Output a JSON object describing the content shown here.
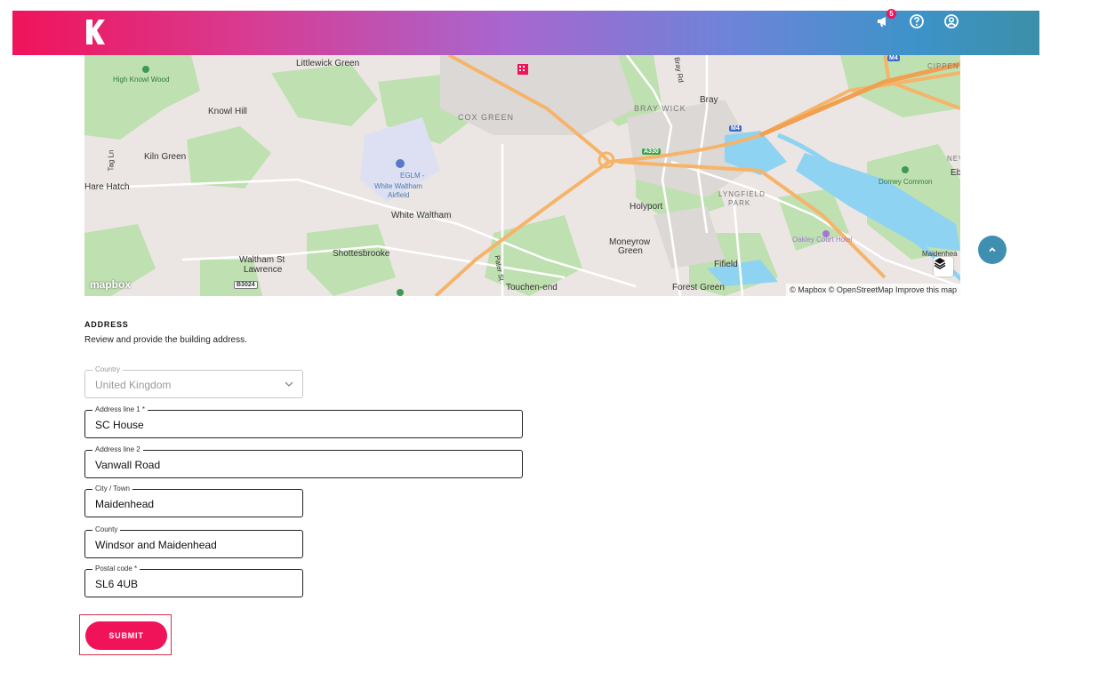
{
  "header": {
    "notifications_count": "5",
    "icons": [
      "megaphone-icon",
      "help-icon",
      "account-icon"
    ],
    "gradient": [
      "#f0135a",
      "#a866cf",
      "#3c8fa8"
    ]
  },
  "map": {
    "labels": {
      "littlewick_green": "Littlewick Green",
      "high_knowl_wood": "High Knowl Wood",
      "knowl_hill": "Knowl Hill",
      "kiln_green": "Kiln Green",
      "hare_hatch": "Hare Hatch",
      "tag_ln": "Tag Ln",
      "eglm": "EGLM -",
      "white_waltham_airfield": "White Waltham",
      "airfield": "Airfield",
      "white_waltham": "White Waltham",
      "waltham_st": "Waltham St",
      "lawrence": "Lawrence",
      "shottesbrooke": "Shottesbrooke",
      "cox_green": "COX GREEN",
      "bray_wick": "BRAY WICK",
      "bray": "Bray",
      "bray_rd": "Bray Rd",
      "holyport": "Holyport",
      "lyngfield": "LYNGFIELD",
      "park": "PARK",
      "moneyrow": "Moneyrow",
      "green": "Green",
      "fifield": "Fifield",
      "pater_st": "Pater St",
      "touchen_end": "Touchen-end",
      "forest_green": "Forest Green",
      "oakley_court": "Oakley Court Hotel",
      "dorney_common": "Dorney Common",
      "cippen": "CIPPEN",
      "maidenhead_edge": "Maidenhea",
      "new": "NEV",
      "eb": "Eb"
    },
    "road_badges": {
      "a330": "A330",
      "m4_top": "M4",
      "m4_mid": "M4",
      "b3024": "B3024"
    },
    "mapbox_logo": "mapbox",
    "attribution": "© Mapbox © OpenStreetMap Improve this map"
  },
  "address": {
    "title": "ADDRESS",
    "description": "Review and provide the building address.",
    "country": {
      "label": "Country",
      "value": "United Kingdom"
    },
    "line1": {
      "label": "Address line 1 *",
      "value": "SC House"
    },
    "line2": {
      "label": "Address line 2",
      "value": "Vanwall Road"
    },
    "city": {
      "label": "City / Town",
      "value": "Maidenhead"
    },
    "county": {
      "label": "County",
      "value": "Windsor and Maidenhead"
    },
    "postal": {
      "label": "Postal code *",
      "value": "SL6 4UB"
    },
    "submit_label": "SUBMIT"
  }
}
